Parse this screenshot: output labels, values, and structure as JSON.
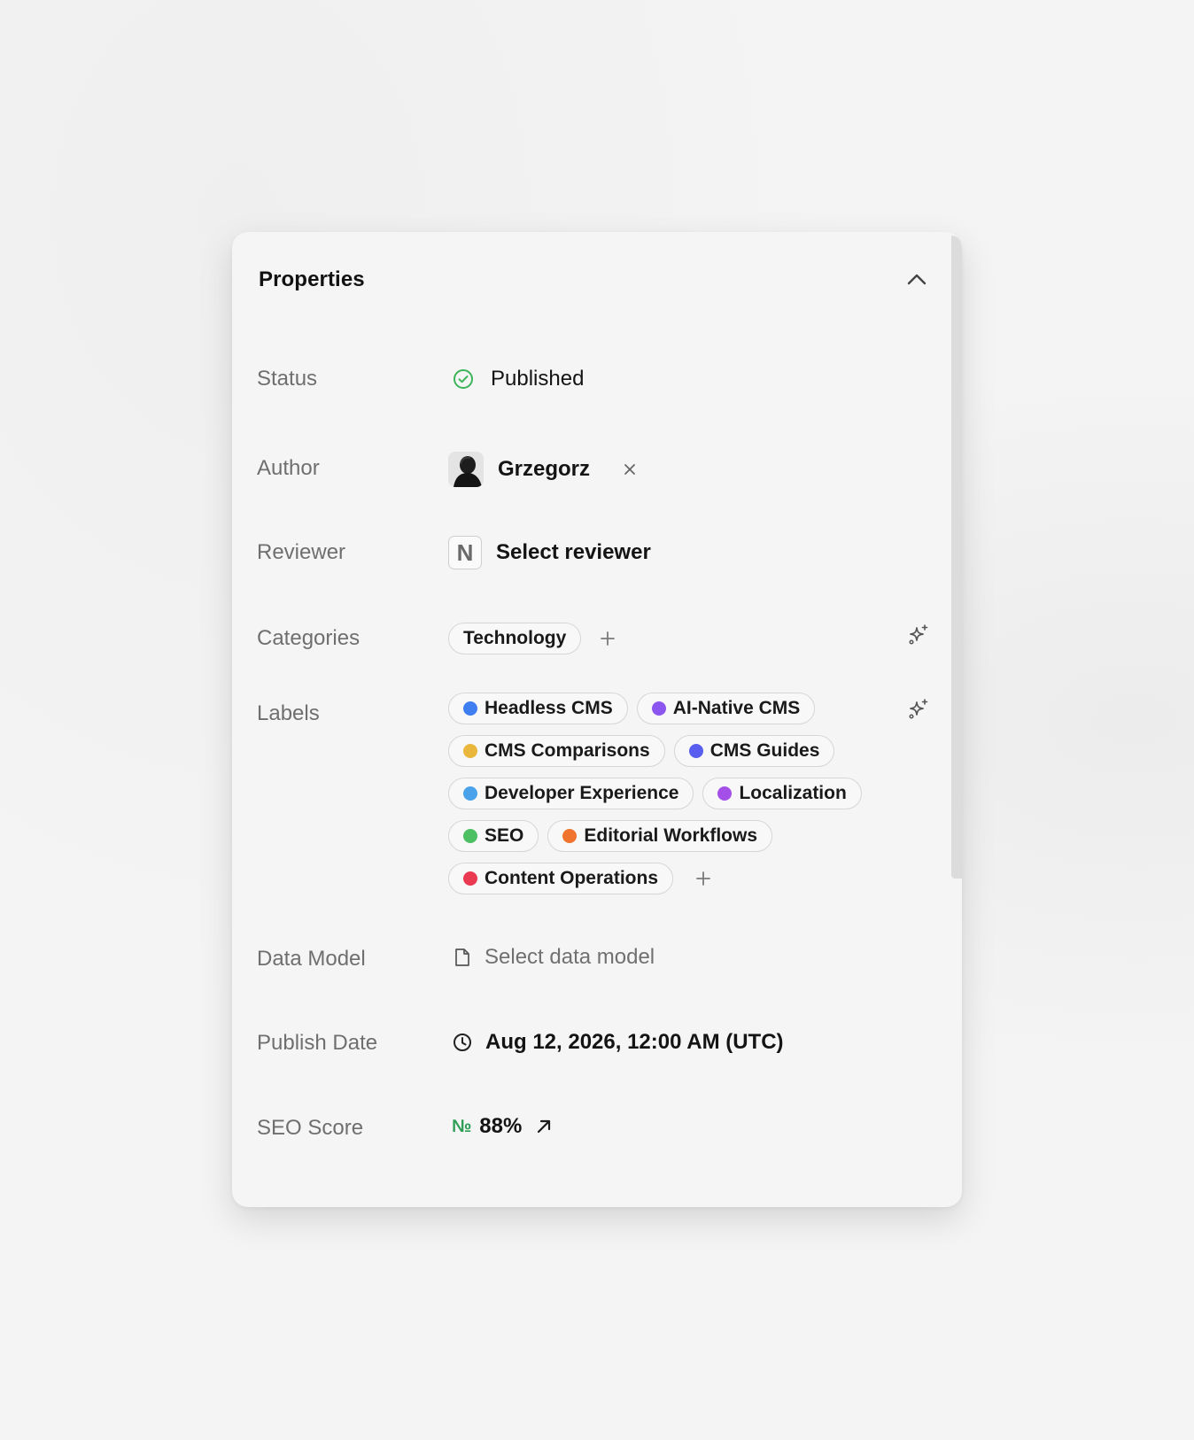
{
  "panel": {
    "title": "Properties"
  },
  "status": {
    "label": "Status",
    "value": "Published",
    "color": "#3cb45a"
  },
  "author": {
    "label": "Author",
    "name": "Grzegorz"
  },
  "reviewer": {
    "label": "Reviewer",
    "initial": "N",
    "placeholder": "Select reviewer"
  },
  "categories": {
    "label": "Categories",
    "items": [
      {
        "label": "Technology"
      }
    ]
  },
  "labels": {
    "label": "Labels",
    "rows": [
      [
        {
          "label": "Headless CMS",
          "color": "#3f7ef0"
        },
        {
          "label": "AI-Native CMS",
          "color": "#8b55f0"
        }
      ],
      [
        {
          "label": "CMS Comparisons",
          "color": "#e9b73b"
        },
        {
          "label": "CMS Guides",
          "color": "#5a5ef0"
        }
      ],
      [
        {
          "label": "Developer Experience",
          "color": "#4aa3ea"
        },
        {
          "label": "Localization",
          "color": "#a54fe9"
        }
      ],
      [
        {
          "label": "SEO",
          "color": "#4cbf62"
        },
        {
          "label": "Editorial Workflows",
          "color": "#f0742e"
        }
      ],
      [
        {
          "label": "Content Operations",
          "color": "#e93a52"
        }
      ]
    ]
  },
  "data_model": {
    "label": "Data Model",
    "placeholder": "Select data model"
  },
  "publish_date": {
    "label": "Publish Date",
    "value": "Aug 12, 2026, 12:00 AM (UTC)"
  },
  "seo_score": {
    "label": "SEO Score",
    "symbol": "№",
    "value": "88%",
    "symbol_color": "#2e9e57"
  },
  "icons": {
    "collapse": "chevron-up-icon",
    "status": "check-circle-icon",
    "remove": "close-icon",
    "add": "plus-icon",
    "ai": "sparkle-icon",
    "data_model": "document-icon",
    "clock": "clock-icon",
    "trend": "arrow-up-right-icon"
  }
}
